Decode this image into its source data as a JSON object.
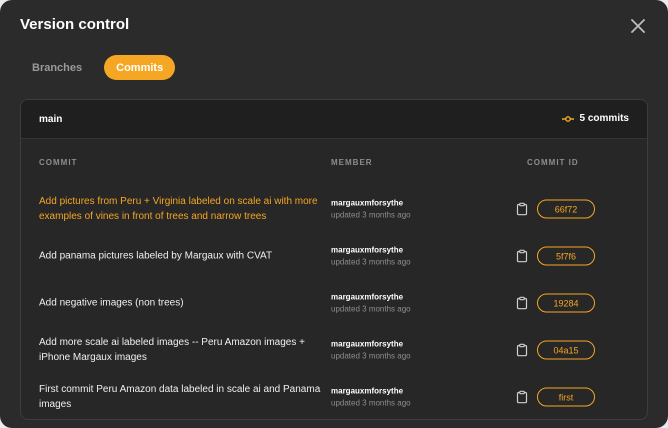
{
  "dialog": {
    "title": "Version control",
    "tabs": [
      {
        "label": "Branches",
        "active": false
      },
      {
        "label": "Commits",
        "active": true
      }
    ]
  },
  "branch": {
    "name": "main",
    "commit_count": "5 commits"
  },
  "table": {
    "headers": {
      "commit": "COMMIT",
      "member": "MEMBER",
      "commit_id": "COMMIT ID"
    },
    "rows": [
      {
        "message": "Add pictures from Peru + Virginia labeled on scale ai with more examples of vines in front of trees and narrow trees",
        "member": "margauxmforsythe",
        "updated": "updated 3 months ago",
        "id": "66f72"
      },
      {
        "message": "Add panama pictures labeled by Margaux with CVAT",
        "member": "margauxmforsythe",
        "updated": "updated 3 months ago",
        "id": "5f7f6"
      },
      {
        "message": "Add negative images (non trees)",
        "member": "margauxmforsythe",
        "updated": "updated 3 months ago",
        "id": "19284"
      },
      {
        "message": "Add more scale ai labeled images -- Peru Amazon images + iPhone Margaux images",
        "member": "margauxmforsythe",
        "updated": "updated 3 months ago",
        "id": "04a15"
      },
      {
        "message": "First commit Peru Amazon data labeled in scale ai and Panama images",
        "member": "margauxmforsythe",
        "updated": "updated 3 months ago",
        "id": "first"
      }
    ]
  },
  "colors": {
    "accent": "#f5a623",
    "background": "#2b2b2b",
    "header_bar": "#1f1f1f"
  },
  "icons": [
    "close-icon",
    "commit-icon",
    "clipboard-icon"
  ]
}
